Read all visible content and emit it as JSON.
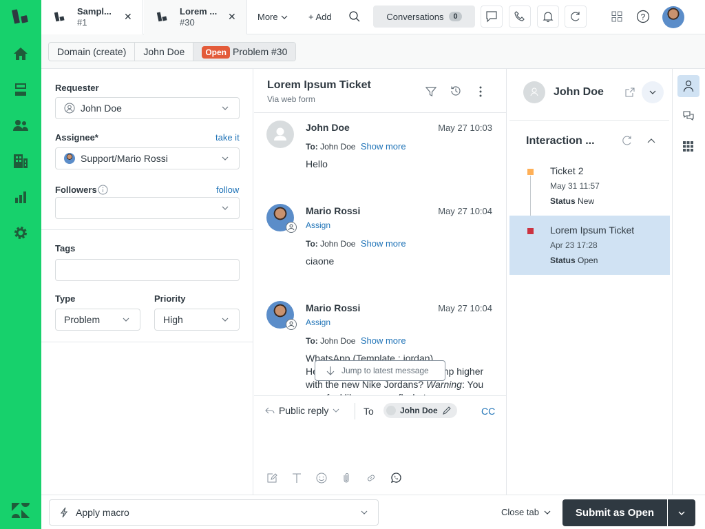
{
  "tabs": [
    {
      "title": "Sampl...",
      "sub": "#1"
    },
    {
      "title": "Lorem ...",
      "sub": "#30"
    }
  ],
  "topbar": {
    "more": "More",
    "add": "+ Add",
    "conversations": "Conversations",
    "conversations_count": "0"
  },
  "breadcrumb": {
    "org": "Domain (create)",
    "user": "John Doe",
    "status_badge": "Open",
    "ticket": "Problem #30"
  },
  "form": {
    "requester_label": "Requester",
    "requester_value": "John Doe",
    "assignee_label": "Assignee*",
    "assignee_link": "take it",
    "assignee_value": "Support/Mario Rossi",
    "followers_label": "Followers",
    "followers_link": "follow",
    "tags_label": "Tags",
    "type_label": "Type",
    "type_value": "Problem",
    "priority_label": "Priority",
    "priority_value": "High"
  },
  "ticket": {
    "title": "Lorem Ipsum Ticket",
    "via": "Via web form"
  },
  "messages": [
    {
      "author": "John Doe",
      "time": "May 27 10:03",
      "to_label": "To:",
      "to": "John Doe",
      "show_more": "Show more",
      "body": "Hello"
    },
    {
      "author": "Mario Rossi",
      "assign": "Assign",
      "time": "May 27 10:04",
      "to_label": "To:",
      "to": "John Doe",
      "show_more": "Show more",
      "body": "ciaone"
    },
    {
      "author": "Mario Rossi",
      "assign": "Assign",
      "time": "May 27 10:04",
      "to_label": "To:",
      "to": "John Doe",
      "show_more": "Show more",
      "body_line1": "WhatsApp (Template : jordan)",
      "body_line2_start": "He",
      "body_line2_end": "mp higher",
      "body_line3": "with the new Nike Jordans? ",
      "body_line3_em": "Warning",
      "body_line3_end": ": You",
      "body_line4": "may feel like you can fly, but we"
    }
  ],
  "jump": "Jump to latest message",
  "reply": {
    "mode": "Public reply",
    "to_label": "To",
    "recipient": "John Doe",
    "cc": "CC"
  },
  "customer": {
    "name": "John Doe"
  },
  "interactions": {
    "title": "Interaction ...",
    "items": [
      {
        "title": "Ticket 2",
        "date": "May 31 11:57",
        "status_label": "Status",
        "status": "New",
        "color": "#ffb057"
      },
      {
        "title": "Lorem Ipsum Ticket",
        "date": "Apr 23 17:28",
        "status_label": "Status",
        "status": "Open",
        "color": "#cc3340"
      }
    ]
  },
  "footer": {
    "macro": "Apply macro",
    "close_tab": "Close tab",
    "submit": "Submit as Open"
  }
}
